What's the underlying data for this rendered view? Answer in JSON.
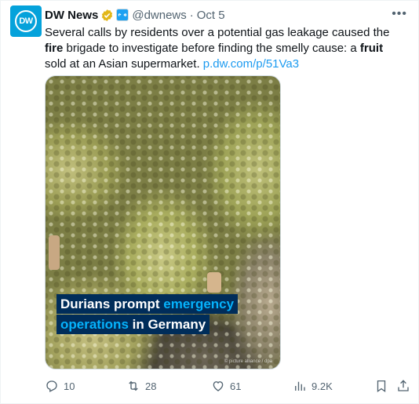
{
  "author": {
    "name": "DW News",
    "handle": "@dwnews",
    "separator": "·",
    "time": "Oct 5",
    "avatar_text": "DW"
  },
  "tweet": {
    "text_1": "Several calls by residents over a potential gas leakage caused the ",
    "bold_1": "fire",
    "text_2": " brigade to investigate before finding the smelly cause: a ",
    "bold_2": "fruit",
    "text_3": " sold at an Asian supermarket. ",
    "link": "p.dw.com/p/51Va3"
  },
  "media": {
    "caption_line1_a": "Durians prompt ",
    "caption_line1_b": "emergency",
    "caption_line2_a": "operations",
    "caption_line2_b": " in Germany",
    "credit": "© picture alliance / dpa"
  },
  "actions": {
    "replies": "10",
    "retweets": "28",
    "likes": "61",
    "views": "9.2K"
  },
  "colors": {
    "link": "#1d9bf0",
    "muted": "#536471",
    "dw_blue": "#05a2db",
    "caption_bg": "#002d5a",
    "caption_highlight": "#05b2fc"
  }
}
